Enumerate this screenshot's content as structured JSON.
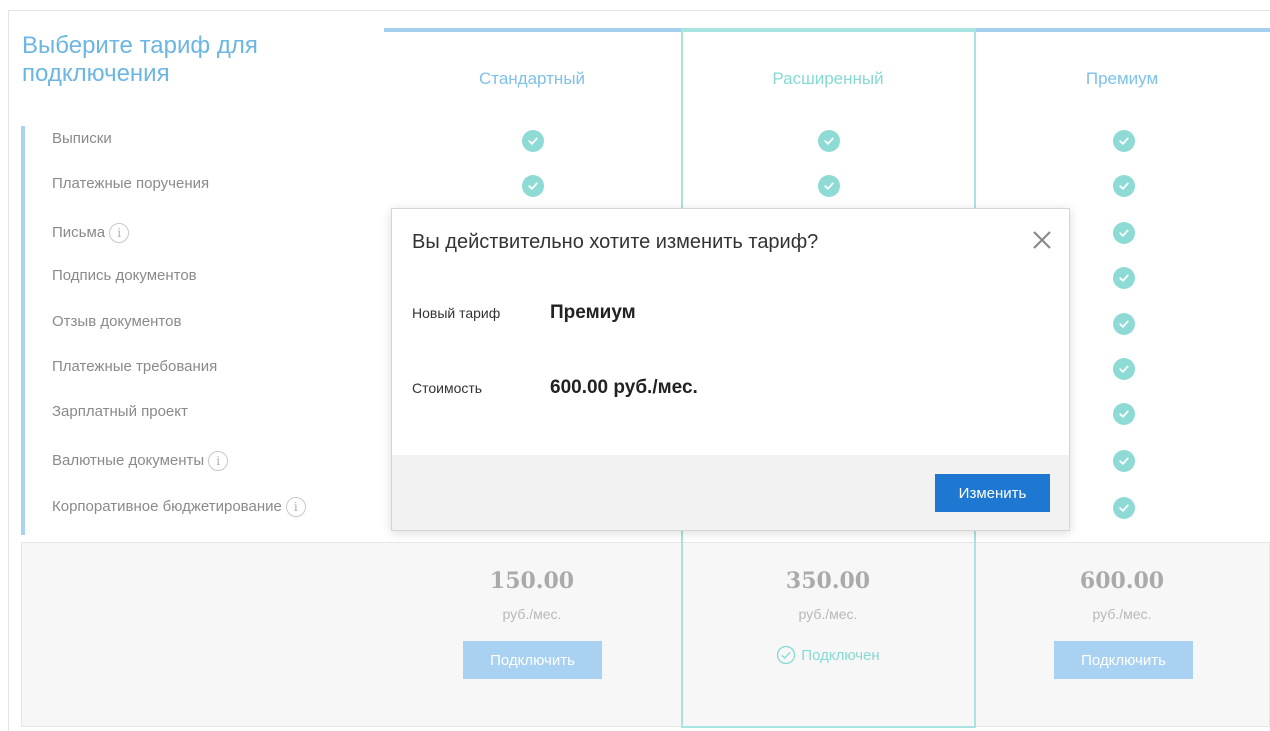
{
  "page": {
    "title": "Выберите тариф для подключения"
  },
  "features": [
    {
      "label": "Выписки",
      "info": false
    },
    {
      "label": "Платежные поручения",
      "info": false
    },
    {
      "label": "Письма",
      "info": true
    },
    {
      "label": "Подпись документов",
      "info": false
    },
    {
      "label": "Отзыв документов",
      "info": false
    },
    {
      "label": "Платежные требования",
      "info": false
    },
    {
      "label": "Зарплатный проект",
      "info": false
    },
    {
      "label": "Валютные документы",
      "info": true
    },
    {
      "label": "Корпоративное бюджетирование",
      "info": true
    }
  ],
  "info_icon": "i",
  "tariffs": [
    {
      "name": "Стандартный",
      "price": "150.00",
      "unit": "руб./мес.",
      "action": "Подключить"
    },
    {
      "name": "Расширенный",
      "price": "350.00",
      "unit": "руб./мес.",
      "status": "Подключен"
    },
    {
      "name": "Премиум",
      "price": "600.00",
      "unit": "руб./мес.",
      "action": "Подключить"
    }
  ],
  "modal": {
    "title": "Вы действительно хотите изменить тариф?",
    "new_tariff_label": "Новый тариф",
    "new_tariff_value": "Премиум",
    "cost_label": "Стоимость",
    "cost_value": "600.00 руб./мес.",
    "confirm_button": "Изменить"
  },
  "colors": {
    "title": "#6cb6e4",
    "check": "#8ddbd4",
    "selected_column": "#a8e4e0",
    "connect_button": "#a9d2f2",
    "confirm_button": "#1e78d2"
  },
  "icons": {
    "check": "check-circle-icon",
    "close": "close-icon",
    "info": "info-icon",
    "connected": "check-circle-outline-icon"
  }
}
